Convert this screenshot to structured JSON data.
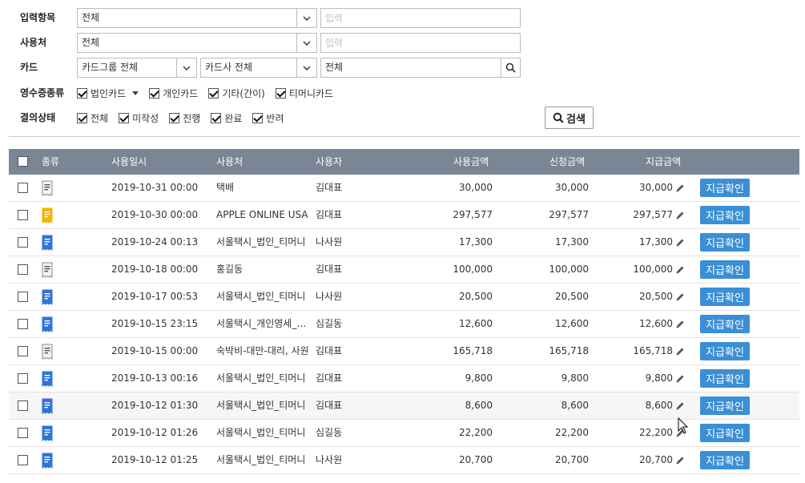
{
  "filters": {
    "input_item": {
      "label": "입력항목",
      "select": "전체",
      "placeholder": "입력"
    },
    "vendor": {
      "label": "사용처",
      "select": "전체",
      "placeholder": "입력"
    },
    "card": {
      "label": "카드",
      "group_select": "카드그룹 전체",
      "company_select": "카드사 전체",
      "value": "전체"
    },
    "receipt_type": {
      "label": "영수증종류",
      "options": [
        "법인카드",
        "개인카드",
        "기타(간이)",
        "티머니카드"
      ]
    },
    "approval_status": {
      "label": "결의상태",
      "options": [
        "전체",
        "미작성",
        "진행",
        "완료",
        "반려"
      ]
    },
    "search_label": "검색"
  },
  "table": {
    "headers": [
      "종류",
      "사용일시",
      "사용처",
      "사용자",
      "사용금액",
      "신청금액",
      "지급금액"
    ],
    "pay_button_label": "지급확인",
    "rows": [
      {
        "doc": "gray",
        "date": "2019-10-31 00:00",
        "vendor": "택배",
        "user": "김대표",
        "used": "30,000",
        "requested": "30,000",
        "paid": "30,000"
      },
      {
        "doc": "yellow",
        "date": "2019-10-30 00:00",
        "vendor": "APPLE ONLINE USA",
        "user": "김대표",
        "used": "297,577",
        "requested": "297,577",
        "paid": "297,577"
      },
      {
        "doc": "blue",
        "date": "2019-10-24 00:13",
        "vendor": "서울택시_법인_티머니",
        "user": "나사원",
        "used": "17,300",
        "requested": "17,300",
        "paid": "17,300"
      },
      {
        "doc": "gray",
        "date": "2019-10-18 00:00",
        "vendor": "홍길동",
        "user": "김대표",
        "used": "100,000",
        "requested": "100,000",
        "paid": "100,000"
      },
      {
        "doc": "blue",
        "date": "2019-10-17 00:53",
        "vendor": "서울택시_법인_티머니",
        "user": "나사원",
        "used": "20,500",
        "requested": "20,500",
        "paid": "20,500"
      },
      {
        "doc": "blue",
        "date": "2019-10-15 23:15",
        "vendor": "서울택시_개인영세_…",
        "user": "심길동",
        "used": "12,600",
        "requested": "12,600",
        "paid": "12,600"
      },
      {
        "doc": "gray",
        "date": "2019-10-15 00:00",
        "vendor": "숙박비-대만-대리, 사원",
        "user": "김대표",
        "used": "165,718",
        "requested": "165,718",
        "paid": "165,718"
      },
      {
        "doc": "blue",
        "date": "2019-10-13 00:16",
        "vendor": "서울택시_법인_티머니",
        "user": "김대표",
        "used": "9,800",
        "requested": "9,800",
        "paid": "9,800"
      },
      {
        "doc": "blue",
        "date": "2019-10-12 01:30",
        "vendor": "서울택시_법인_티머니",
        "user": "김대표",
        "used": "8,600",
        "requested": "8,600",
        "paid": "8,600"
      },
      {
        "doc": "blue",
        "date": "2019-10-12 01:26",
        "vendor": "서울택시_법인_티머니",
        "user": "심길동",
        "used": "22,200",
        "requested": "22,200",
        "paid": "22,200"
      },
      {
        "doc": "blue",
        "date": "2019-10-12 01:25",
        "vendor": "서울택시_법인_티머니",
        "user": "나사원",
        "used": "20,700",
        "requested": "20,700",
        "paid": "20,700"
      }
    ]
  },
  "colors": {
    "header_bg": "#7a8595",
    "pay_button": "#3a8fd6",
    "doc_gray": "#9e9e9e",
    "doc_blue": "#2f73d9",
    "doc_yellow": "#f4b400"
  }
}
